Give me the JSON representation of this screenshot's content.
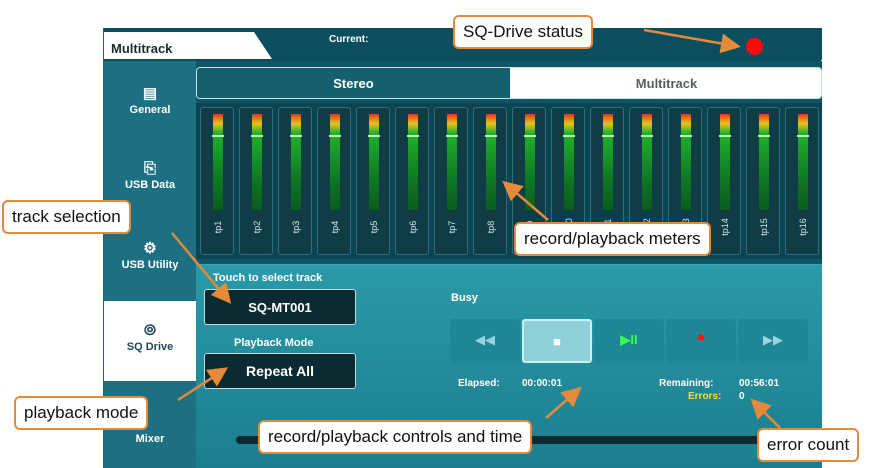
{
  "header": {
    "tab_title": "Multitrack",
    "current_label": "Current:"
  },
  "sidebar": {
    "items": [
      {
        "label": "General",
        "icon": "general-icon",
        "glyph": "▤"
      },
      {
        "label": "USB Data",
        "icon": "usb-data-icon",
        "glyph": "⎘"
      },
      {
        "label": "USB Utility",
        "icon": "usb-utility-icon",
        "glyph": "⚙"
      },
      {
        "label": "SQ Drive",
        "icon": "sq-drive-icon",
        "glyph": "⦾"
      },
      {
        "label": "Mixer",
        "icon": "mixer-icon",
        "glyph": ""
      }
    ]
  },
  "mode_tabs": [
    {
      "label": "Stereo"
    },
    {
      "label": "Multitrack"
    }
  ],
  "meters": {
    "labels": [
      "tp1",
      "tp2",
      "tp3",
      "tp4",
      "tp5",
      "tp6",
      "tp7",
      "tp8",
      "tp9",
      "tp10",
      "tp11",
      "tp12",
      "tp13",
      "tp14",
      "tp15",
      "tp16"
    ]
  },
  "controls": {
    "track_label": "Touch to select track",
    "track_value": "SQ-MT001",
    "playback_label": "Playback Mode",
    "playback_value": "Repeat All",
    "status": "Busy",
    "transport": [
      {
        "name": "rewind-button",
        "glyph": "◀◀"
      },
      {
        "name": "stop-button",
        "glyph": "■"
      },
      {
        "name": "play-pause-button",
        "glyph": "▶II"
      },
      {
        "name": "record-button",
        "glyph": "●"
      },
      {
        "name": "fast-forward-button",
        "glyph": "▶▶"
      }
    ],
    "elapsed_label": "Elapsed:",
    "elapsed_value": "00:00:01",
    "remaining_label": "Remaining:",
    "remaining_value": "00:56:01",
    "errors_label": "Errors:",
    "errors_value": "0"
  },
  "annotations": {
    "sq_drive_status": "SQ-Drive status",
    "track_selection": "track selection",
    "meters": "record/playback meters",
    "playback_mode": "playback mode",
    "controls_time": "record/playback controls and time",
    "error_count": "error count"
  },
  "colors": {
    "accent": "#e58a3a",
    "status_red": "#ff0a0a",
    "panel_teal": "#0f5566"
  }
}
